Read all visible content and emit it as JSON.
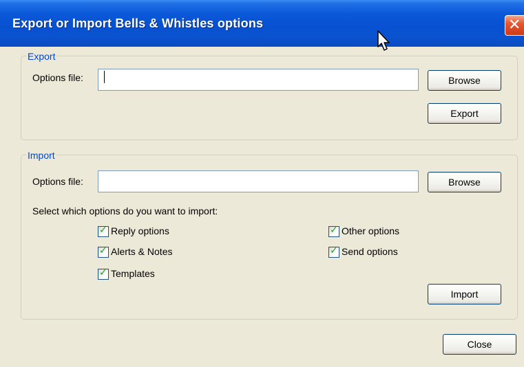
{
  "window": {
    "title": "Export or Import Bells & Whistles options",
    "close_glyph": "✕"
  },
  "export": {
    "group_label": "Export",
    "options_file_label": "Options file:",
    "options_file_value": "",
    "browse_label": "Browse",
    "export_label": "Export"
  },
  "import": {
    "group_label": "Import",
    "options_file_label": "Options file:",
    "options_file_value": "",
    "browse_label": "Browse",
    "select_prompt": "Select which options do you want to import:",
    "options": [
      {
        "label": "Reply options",
        "checked": true
      },
      {
        "label": "Alerts & Notes",
        "checked": true
      },
      {
        "label": "Templates",
        "checked": true
      },
      {
        "label": "Other options",
        "checked": true
      },
      {
        "label": "Send options",
        "checked": true
      }
    ],
    "check_glyph": "✓",
    "import_label": "Import"
  },
  "footer": {
    "close_label": "Close"
  },
  "colors": {
    "titlebar": "#0a58d8",
    "client_bg": "#ece9d8",
    "group_label": "#0046d5",
    "close_button": "#e4572f",
    "check_mark": "#21a121"
  },
  "icons": {
    "close": "close-icon",
    "check": "checkmark-icon",
    "cursor": "mouse-pointer-icon"
  }
}
